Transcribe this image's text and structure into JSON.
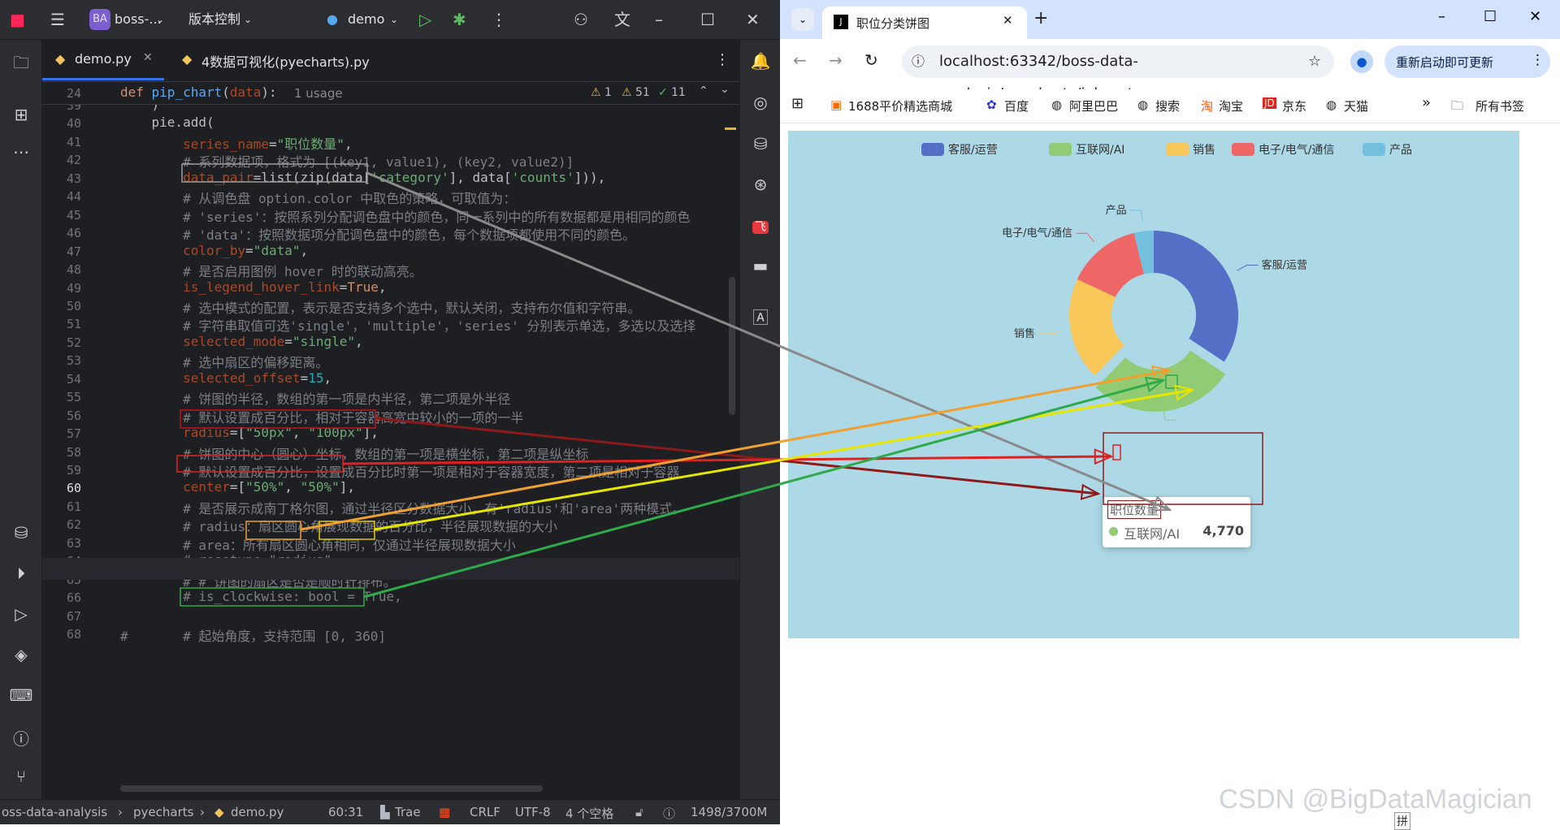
{
  "ide": {
    "project_badge": "BA",
    "project_name": "boss-...",
    "vcs_label": "版本控制",
    "run_config": "demo",
    "tabs": [
      {
        "label": "demo.py"
      },
      {
        "label": "4数据可视化(pyecharts).py"
      }
    ],
    "sticky": {
      "line": "24",
      "text": "def pip_chart(data):",
      "usage": "1 usage"
    },
    "inspections": {
      "warn1": "1",
      "warn2": "51",
      "ok": "11"
    },
    "lines": [
      {
        "n": "39",
        "t": "    )"
      },
      {
        "n": "40",
        "t": "    pie.add("
      },
      {
        "n": "41",
        "t": "        series_name=\"职位数量\","
      },
      {
        "n": "42",
        "t": "        # 系列数据项，格式为 [(key1, value1), (key2, value2)]"
      },
      {
        "n": "43",
        "t": "        data_pair=list(zip(data['category'], data['counts'])),"
      },
      {
        "n": "44",
        "t": "        # 从调色盘 option.color 中取色的策略，可取值为："
      },
      {
        "n": "45",
        "t": "        # 'series'：按照系列分配调色盘中的颜色，同一系列中的所有数据都是用相同的颜色"
      },
      {
        "n": "46",
        "t": "        # 'data'：按照数据项分配调色盘中的颜色，每个数据项都使用不同的颜色。"
      },
      {
        "n": "47",
        "t": "        color_by=\"data\","
      },
      {
        "n": "48",
        "t": "        # 是否启用图例 hover 时的联动高亮。"
      },
      {
        "n": "49",
        "t": "        is_legend_hover_link=True,"
      },
      {
        "n": "50",
        "t": "        # 选中模式的配置，表示是否支持多个选中，默认关闭，支持布尔值和字符串。"
      },
      {
        "n": "51",
        "t": "        # 字符串取值可选'single'，'multiple'，'series' 分别表示单选，多选以及选择"
      },
      {
        "n": "52",
        "t": "        selected_mode=\"single\","
      },
      {
        "n": "53",
        "t": "        # 选中扇区的偏移距离。"
      },
      {
        "n": "54",
        "t": "        selected_offset=15,"
      },
      {
        "n": "55",
        "t": "        # 饼图的半径，数组的第一项是内半径，第二项是外半径"
      },
      {
        "n": "56",
        "t": "        # 默认设置成百分比，相对于容器高宽中较小的一项的一半"
      },
      {
        "n": "57",
        "t": "        radius=[\"50px\", \"100px\"],"
      },
      {
        "n": "58",
        "t": "        # 饼图的中心（圆心）坐标，数组的第一项是横坐标，第二项是纵坐标"
      },
      {
        "n": "59",
        "t": "        # 默认设置成百分比，设置成百分比时第一项是相对于容器宽度，第二项是相对于容器"
      },
      {
        "n": "60",
        "t": "        center=[\"50%\", \"50%\"],"
      },
      {
        "n": "61",
        "t": "        # 是否展示成南丁格尔图，通过半径区分数据大小，有'radius'和'area'两种模式。"
      },
      {
        "n": "62",
        "t": "        # radius：扇区圆心角展现数据的百分比，半径展现数据的大小"
      },
      {
        "n": "63",
        "t": "        # area：所有扇区圆心角相同，仅通过半径展现数据大小"
      },
      {
        "n": "64",
        "t": "        # rosetype=\"radius\","
      },
      {
        "n": "65",
        "t": "        # # 饼图的扇区是否是顺时针排布。"
      },
      {
        "n": "66",
        "t": "        # is_clockwise: bool = True,"
      },
      {
        "n": "67",
        "t": ""
      },
      {
        "n": "68",
        "t": "#       # 起始角度，支持范围 [0, 360]"
      }
    ],
    "status": {
      "project": "oss-data-analysis",
      "folder": "pyecharts",
      "file": "demo.py",
      "pos": "60:31",
      "plugin": "Trae",
      "eol": "CRLF",
      "enc": "UTF-8",
      "indent": "4 个空格",
      "mem": "1498/3700M"
    }
  },
  "browser": {
    "tab_title": "职位分类饼图",
    "url": "localhost:63342/boss-data-analysis/pyecharts/job_cat...",
    "update_button": "重新启动即可更新",
    "bookmarks": [
      "1688平价精选商城",
      "百度",
      "阿里巴巴",
      "搜索",
      "淘宝",
      "京东",
      "天猫"
    ],
    "all_bookmarks": "所有书签"
  },
  "chart_data": {
    "type": "pie",
    "series_name": "职位数量",
    "legend": [
      "客服/运营",
      "互联网/AI",
      "销售",
      "电子/电气/通信",
      "产品"
    ],
    "colors": [
      "#5470c6",
      "#91cc75",
      "#fac858",
      "#ee6666",
      "#73c0de"
    ],
    "categories": [
      "客服/运营",
      "互联网/AI",
      "销售",
      "电子/电气/通信",
      "产品"
    ],
    "values": [
      5850,
      4770,
      3350,
      2430,
      640
    ],
    "radius": [
      "50px",
      "100px"
    ],
    "center": [
      "50%",
      "50%"
    ],
    "selected": "互联网/AI",
    "tooltip": {
      "series": "职位数量",
      "name": "互联网/AI",
      "value": "4,770"
    }
  },
  "watermark": "CSDN @BigDataMagician"
}
